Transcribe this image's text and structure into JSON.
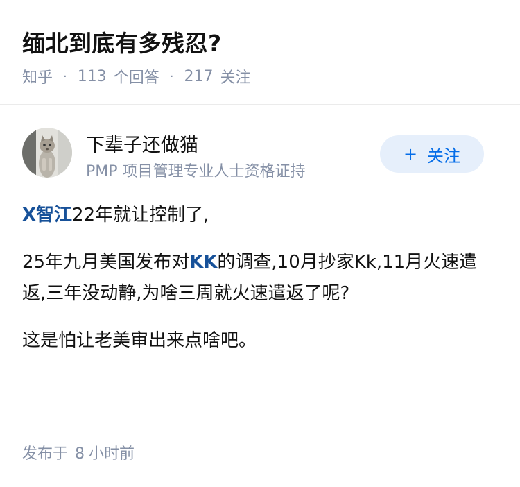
{
  "question": {
    "title": "缅北到底有多残忍?",
    "source": "知乎",
    "separator": "·",
    "answers_count": "113",
    "answers_label": "个回答",
    "followers_count": "217",
    "followers_label": "关注"
  },
  "author": {
    "name": "下辈子还做猫",
    "bio": "PMP 项目管理专业人士资格证持",
    "follow_button": {
      "icon": "plus-icon",
      "icon_glyph": "+",
      "label": "关注",
      "color": "#056de8",
      "background": "#e6effb"
    }
  },
  "answer": {
    "paragraphs": [
      {
        "link1": "X智江",
        "text1": "22年就让控制了,"
      },
      {
        "text1": "25年九月美国发布对",
        "link1": "KK",
        "text2": "的调查,10月抄家Kk,11月火速遣返,三年没动静,为啥三周就火速遣返了呢?"
      },
      {
        "text1": "这是怕让老美审出来点啥吧。"
      }
    ],
    "link_color": "#175199"
  },
  "footer": {
    "published_label": "发布于",
    "time_value": "8",
    "time_unit": "小时前"
  }
}
